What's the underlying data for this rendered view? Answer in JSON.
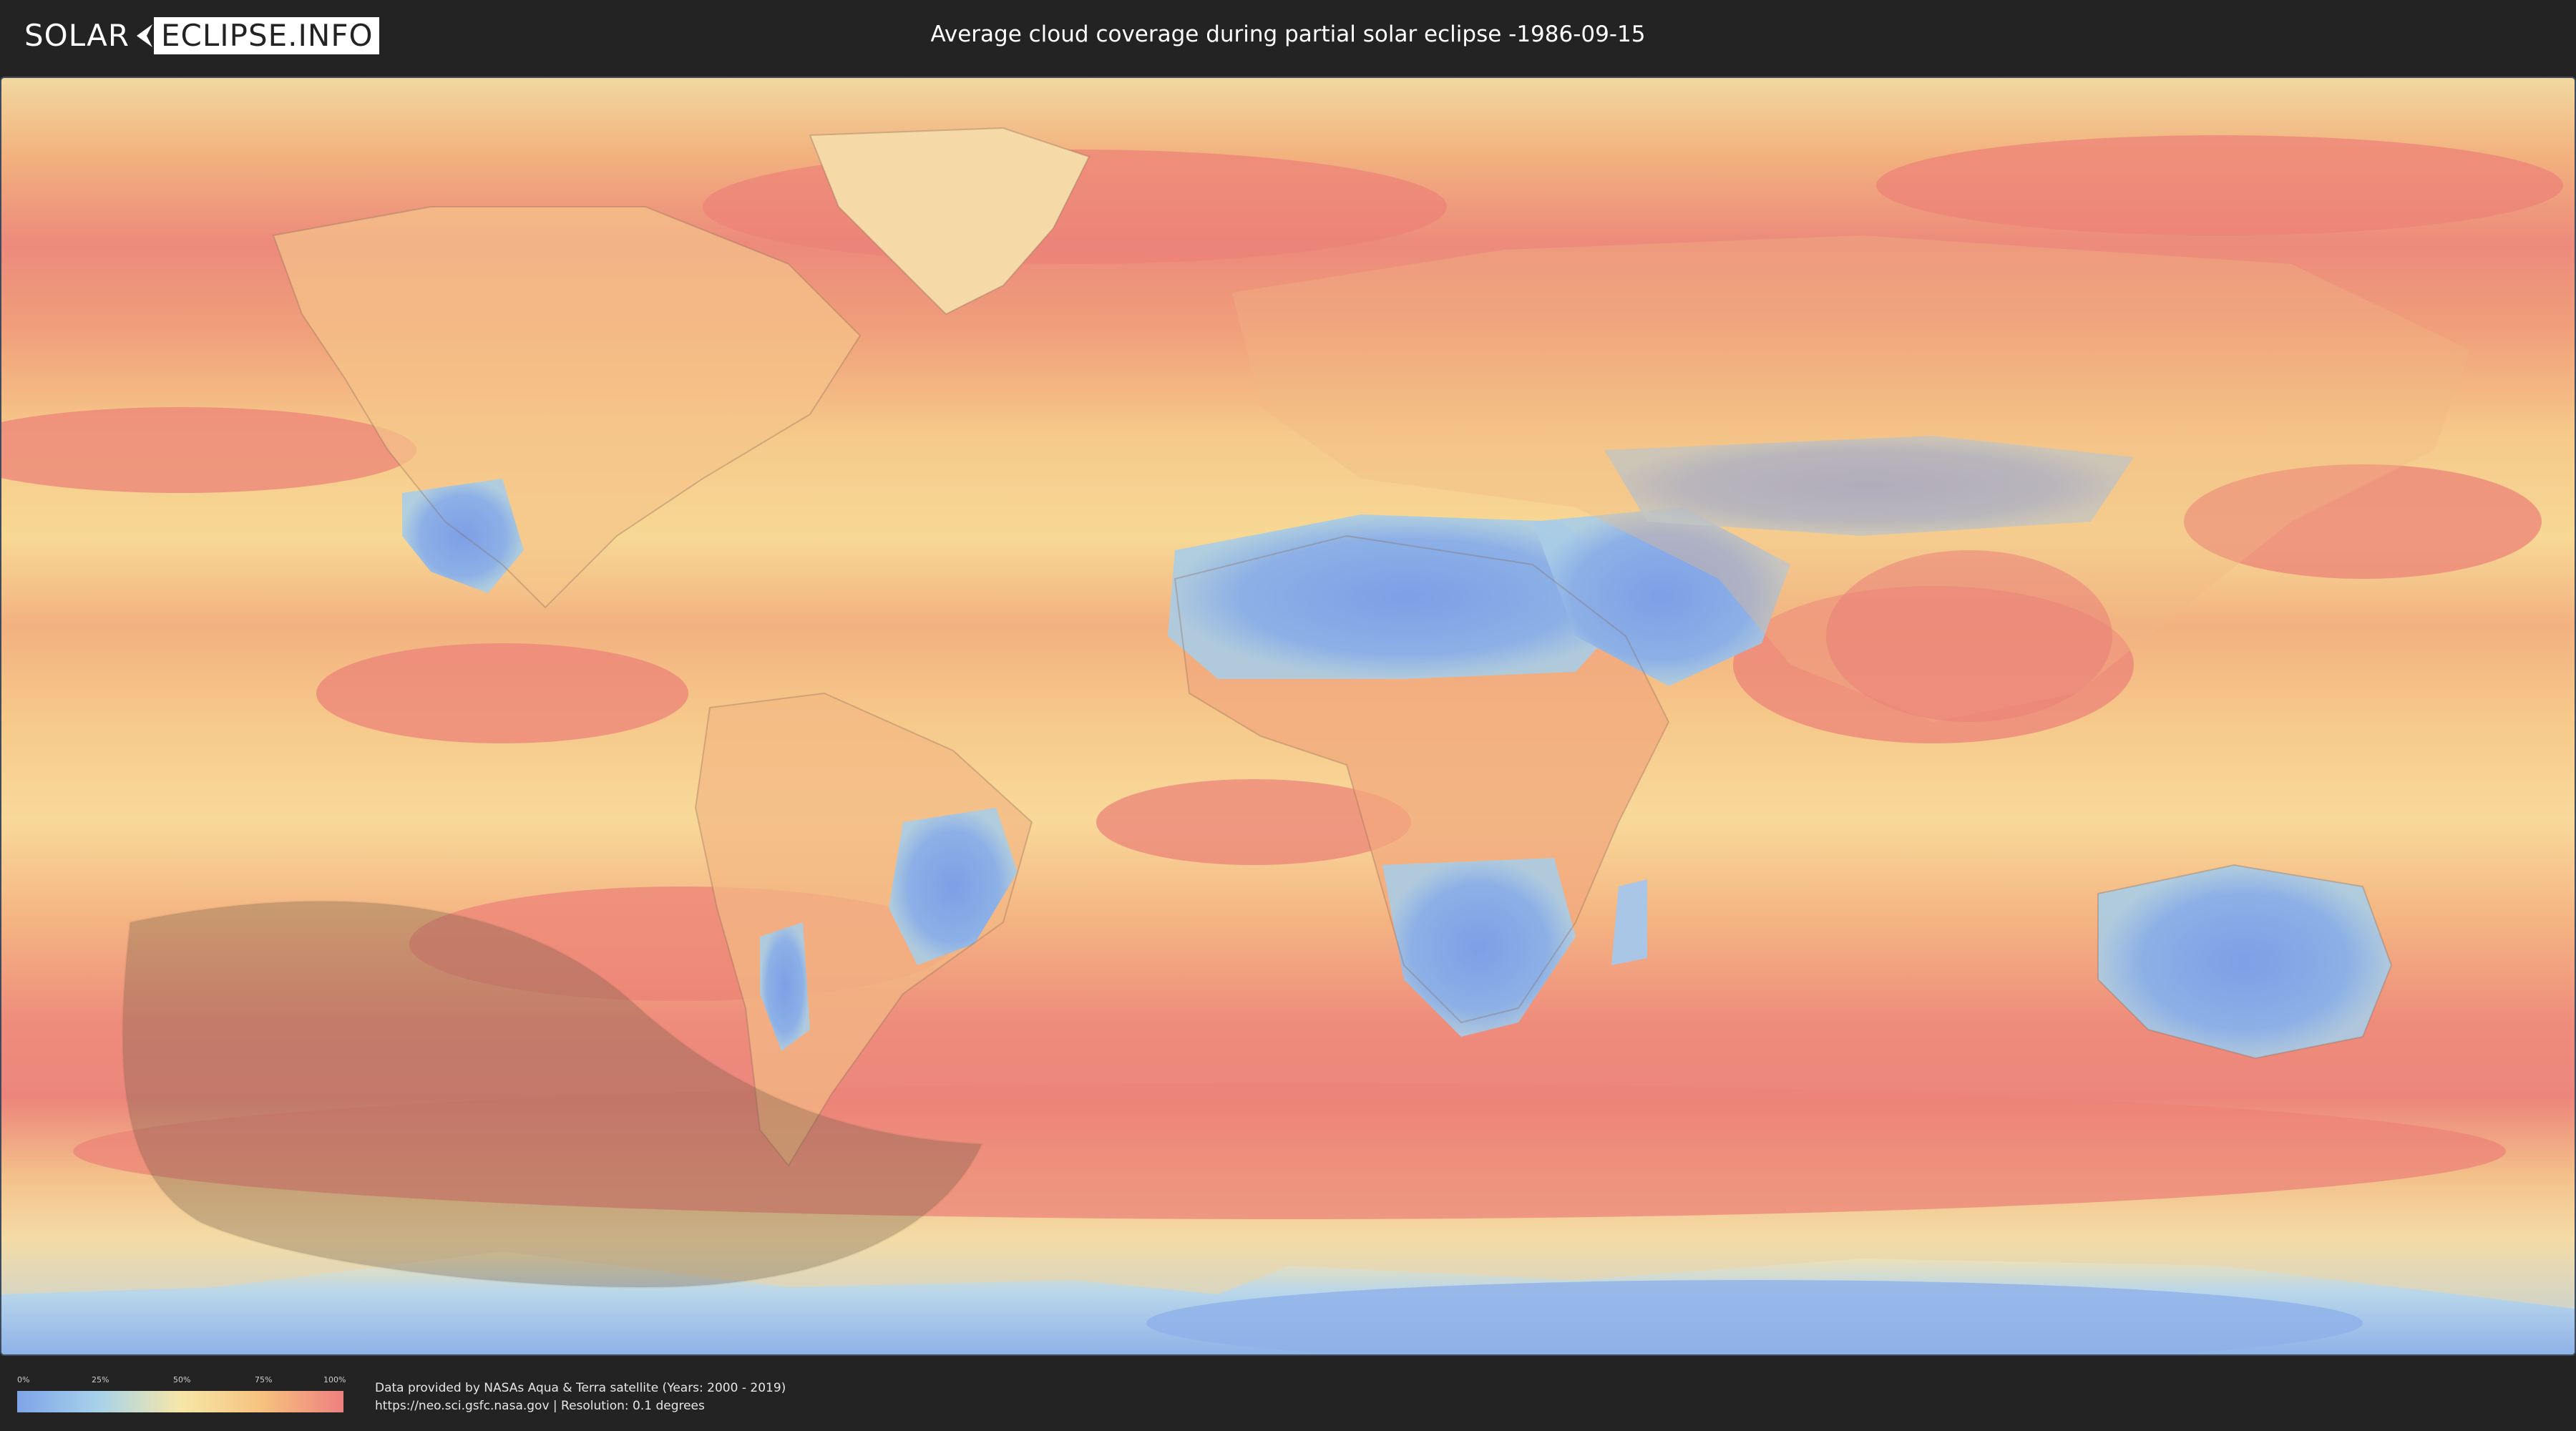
{
  "header": {
    "logo_left": "SOLAR",
    "logo_right": "ECLIPSE.INFO",
    "title": "Average cloud coverage during partial solar eclipse -1986-09-15"
  },
  "legend": {
    "ticks": [
      "0%",
      "25%",
      "50%",
      "75%",
      "100%"
    ],
    "colors": [
      "#7ea4e8",
      "#a8d2ea",
      "#f6e7a8",
      "#f6c27e",
      "#ee8080"
    ]
  },
  "footer": {
    "credit_line1": "Data provided by NASAs Aqua & Terra satellite (Years: 2000 - 2019)",
    "credit_line2": "https://neo.sci.gsfc.nasa.gov | Resolution: 0.1 degrees"
  },
  "map": {
    "projection": "equirectangular",
    "eclipse_region": "partial eclipse visibility zone over the South Pacific and Antarctica",
    "colors": {
      "ocean_cloudy": "#ee8a80",
      "ocean_mid": "#f6c488",
      "clear_land": "#86a9e8",
      "eclipse_shade": "#6e5a46"
    }
  }
}
